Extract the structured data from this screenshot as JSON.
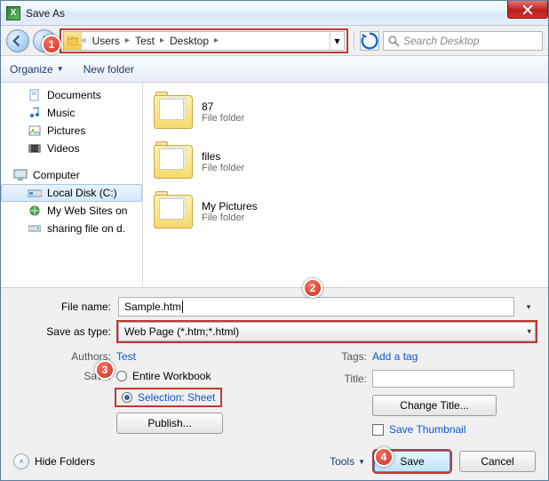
{
  "window": {
    "title": "Save As"
  },
  "nav": {
    "crumbs": [
      "Users",
      "Test",
      "Desktop"
    ],
    "search_placeholder": "Search Desktop"
  },
  "toolbar": {
    "organize": "Organize",
    "new_folder": "New folder"
  },
  "sidebar": {
    "libs": [
      "Documents",
      "Music",
      "Pictures",
      "Videos"
    ],
    "computer_label": "Computer",
    "drives": [
      "Local Disk (C:)",
      "My Web Sites on",
      "sharing file on d."
    ]
  },
  "files": [
    {
      "name": "87",
      "type": "File folder"
    },
    {
      "name": "files",
      "type": "File folder"
    },
    {
      "name": "My Pictures",
      "type": "File folder"
    }
  ],
  "form": {
    "filename_label": "File name:",
    "filename_value": "Sample.htm",
    "savetype_label": "Save as type:",
    "savetype_value": "Web Page (*.htm;*.html)",
    "authors_label": "Authors:",
    "authors_value": "Test",
    "tags_label": "Tags:",
    "tags_value": "Add a tag",
    "save_label": "Save:",
    "radio_entire": "Entire Workbook",
    "radio_selection": "Selection: Sheet",
    "publish_btn": "Publish...",
    "title_label": "Title:",
    "change_title_btn": "Change Title...",
    "save_thumb": "Save Thumbnail"
  },
  "footer": {
    "hide_folders": "Hide Folders",
    "tools": "Tools",
    "save": "Save",
    "cancel": "Cancel"
  },
  "callouts": {
    "c1": "1",
    "c2": "2",
    "c3": "3",
    "c4": "4"
  }
}
